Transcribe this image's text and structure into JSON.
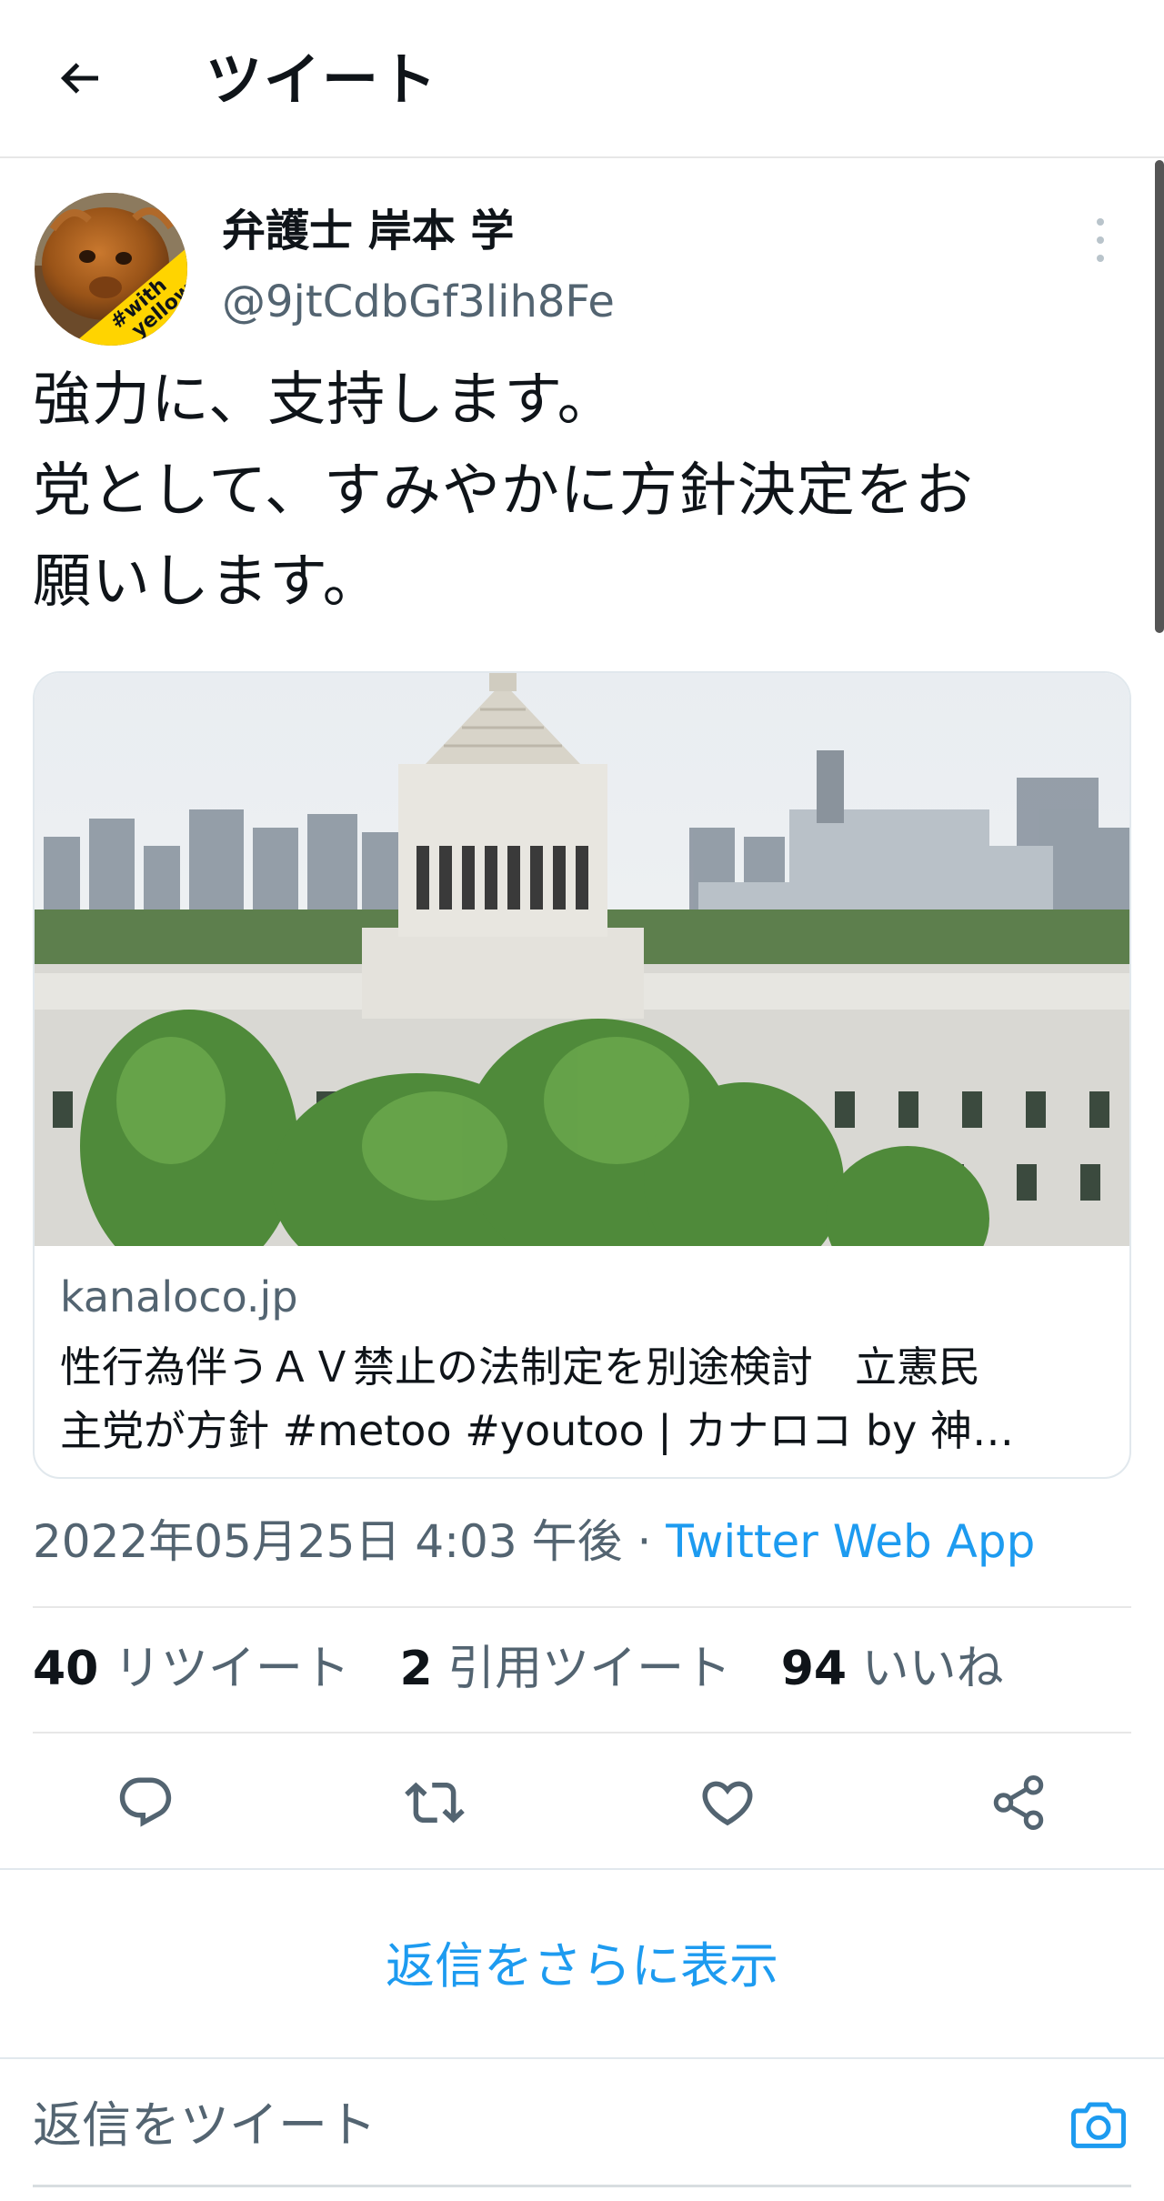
{
  "header": {
    "title": "ツイート",
    "back_icon": "back-arrow-icon"
  },
  "tweet": {
    "author_name": "弁護士 岸本 学",
    "author_handle": "@9jtCdbGf3lih8Fe",
    "avatar_badge_line1": "#with",
    "avatar_badge_line2": "yellow",
    "text": "強力に、支持します。\n党として、すみやかに方針決定をお\n願いします。",
    "card": {
      "domain": "kanaloco.jp",
      "title": "性行為伴うＡＶ禁止の法制定を別途検討　立憲民\n主党が方針 #metoo #youtoo | カナロコ by 神…"
    },
    "timestamp": "2022年05月25日 4:03 午後 · ",
    "source_app": "Twitter Web App",
    "stats": {
      "retweets_count": "40",
      "retweets_label": "リツイート",
      "quotes_count": "2",
      "quotes_label": "引用ツイート",
      "likes_count": "94",
      "likes_label": "いいね"
    }
  },
  "actions": [
    "reply-icon",
    "retweet-icon",
    "like-icon",
    "share-icon"
  ],
  "more_replies_label": "返信をさらに表示",
  "reply_placeholder": "返信をツイート",
  "colors": {
    "accent": "#1d9bf0",
    "secondary_text": "#536471",
    "primary_text": "#0f1419",
    "avatar_badge": "#ffd400"
  }
}
